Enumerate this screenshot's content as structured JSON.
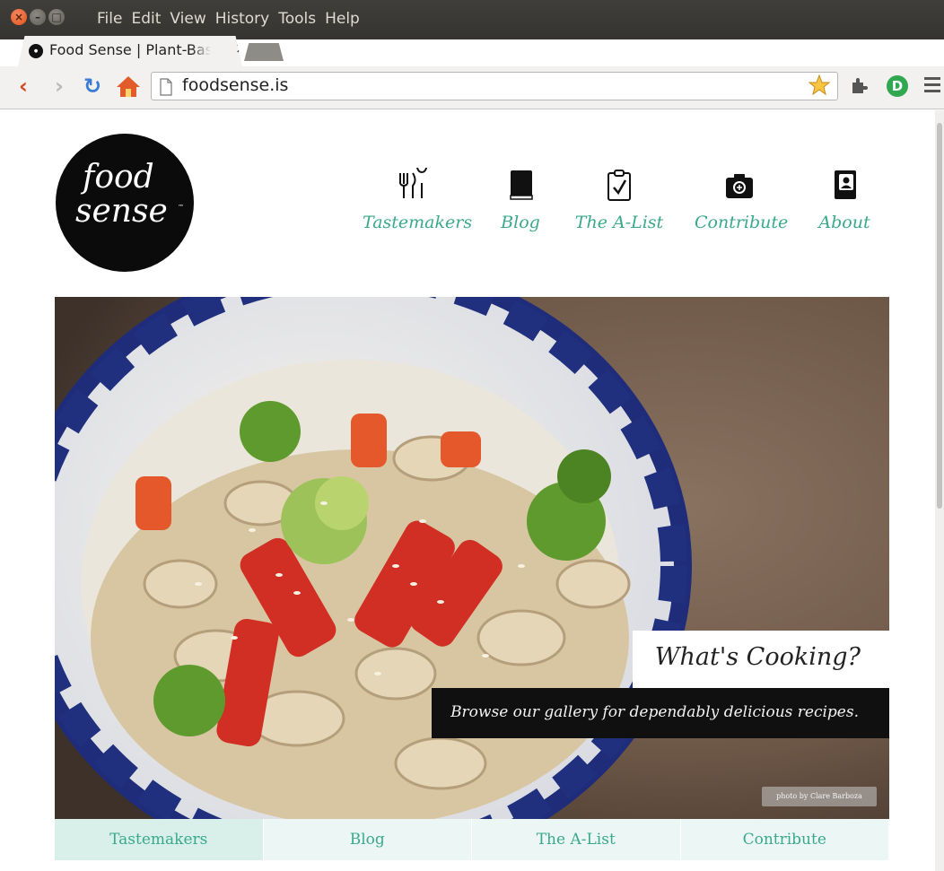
{
  "window": {
    "menu": [
      "File",
      "Edit",
      "View",
      "History",
      "Tools",
      "Help"
    ]
  },
  "tab": {
    "title": "Food Sense | Plant-Based",
    "close": "×"
  },
  "toolbar": {
    "url": "foodsense.is"
  },
  "logo": {
    "line1": "food",
    "line2": "sense",
    "tm": "™"
  },
  "nav": [
    {
      "label": "Tastemakers",
      "icon": "utensils-icon"
    },
    {
      "label": "Blog",
      "icon": "book-icon"
    },
    {
      "label": "The A-List",
      "icon": "clipboard-check-icon"
    },
    {
      "label": "Contribute",
      "icon": "camera-icon"
    },
    {
      "label": "About",
      "icon": "contact-book-icon"
    }
  ],
  "hero": {
    "title": "What's Cooking?",
    "subtitle": "Browse our gallery for dependably delicious recipes.",
    "credit": "photo by Clare Barboza"
  },
  "subnav": {
    "items": [
      "Tastemakers",
      "Blog",
      "The A-List",
      "Contribute"
    ],
    "active_index": 0
  },
  "colors": {
    "accent": "#3aa98a",
    "subnav_bg": "#ecf7f5",
    "subnav_active_bg": "#d8efea"
  }
}
